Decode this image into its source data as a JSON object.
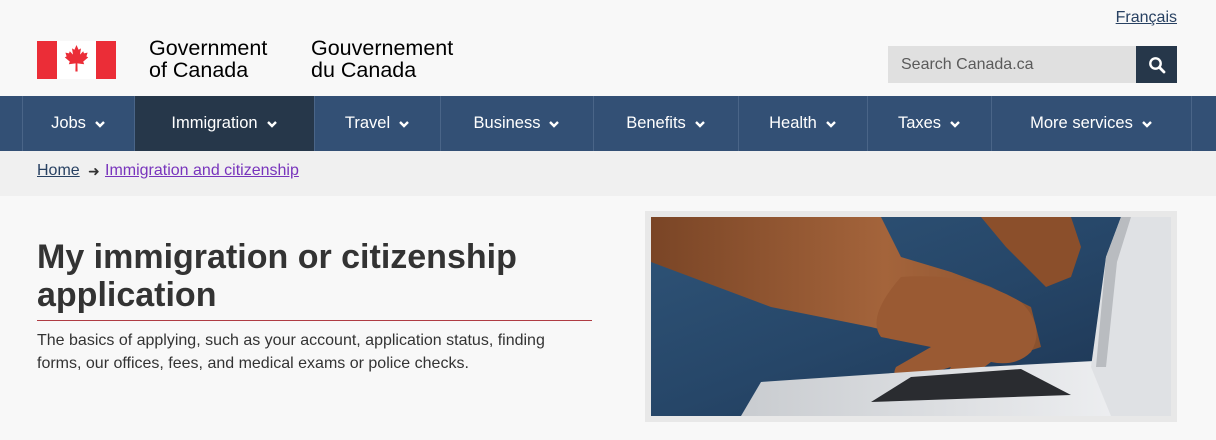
{
  "header": {
    "language_link": "Français",
    "wordmark_en_line1": "Government",
    "wordmark_en_line2": "of Canada",
    "wordmark_fr_line1": "Gouvernement",
    "wordmark_fr_line2": "du Canada",
    "search_placeholder": "Search Canada.ca",
    "search_icon": "search-icon",
    "flag_icon": "canada-flag-icon"
  },
  "nav": {
    "items": [
      {
        "label": "Jobs"
      },
      {
        "label": "Immigration"
      },
      {
        "label": "Travel"
      },
      {
        "label": "Business"
      },
      {
        "label": "Benefits"
      },
      {
        "label": "Health"
      },
      {
        "label": "Taxes"
      },
      {
        "label": "More services"
      }
    ],
    "active": "Immigration"
  },
  "breadcrumb": {
    "items": [
      {
        "label": "Home"
      },
      {
        "label": "Immigration and citizenship"
      }
    ]
  },
  "main": {
    "title": "My immigration or citizenship application",
    "description": "The basics of applying, such as your account, application status, finding forms, our offices, fees, and medical exams or police checks."
  },
  "colors": {
    "nav_bg": "#335075",
    "nav_active": "#26374a",
    "flag_red": "#eb2d37",
    "link": "#284162",
    "visited_link": "#7834bc",
    "title_rule": "#af3c43"
  }
}
